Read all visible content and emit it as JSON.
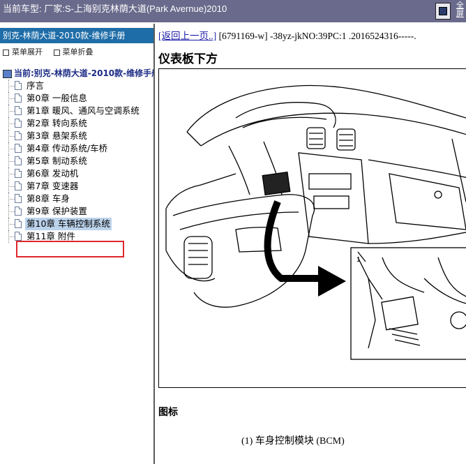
{
  "topbar": {
    "title": "当前车型:  厂家:S-上海别克林荫大道(Park Avernue)2010",
    "fullscreen_label": "全屏"
  },
  "sidebar": {
    "manual_title": "别克-林荫大道-2010款-维修手册",
    "expand_label": "菜单展开",
    "collapse_label": "菜单折叠",
    "current_label": "当前:别克-林荫大道-2010款-维修手册",
    "toc": [
      {
        "label": "序言"
      },
      {
        "label": "第0章 一般信息"
      },
      {
        "label": "第1章 暖风、通风与空调系统"
      },
      {
        "label": "第2章 转向系统"
      },
      {
        "label": "第3章 悬架系统"
      },
      {
        "label": "第4章 传动系统/车桥"
      },
      {
        "label": "第5章 制动系统"
      },
      {
        "label": "第6章 发动机"
      },
      {
        "label": "第7章 变速器"
      },
      {
        "label": "第8章 车身"
      },
      {
        "label": "第9章 保护装置"
      },
      {
        "label": "第10章 车辆控制系统",
        "selected": true
      },
      {
        "label": "第11章 附件"
      }
    ]
  },
  "content": {
    "back_link": "[返回上一页..]",
    "doc_id": " [6791169-w] -38yz-jkNO:39PC:1 .2016524316-----.",
    "heading": "仪表板下方",
    "figure_callout": "1",
    "legend_title": "图标",
    "legend_item": "(1) 车身控制模块 (BCM)"
  },
  "colors": {
    "topbar_bg": "#6a6a8c",
    "manual_title_bg": "#1f6da8",
    "highlight_border": "#e0262a",
    "link": "#1a1aa6"
  }
}
